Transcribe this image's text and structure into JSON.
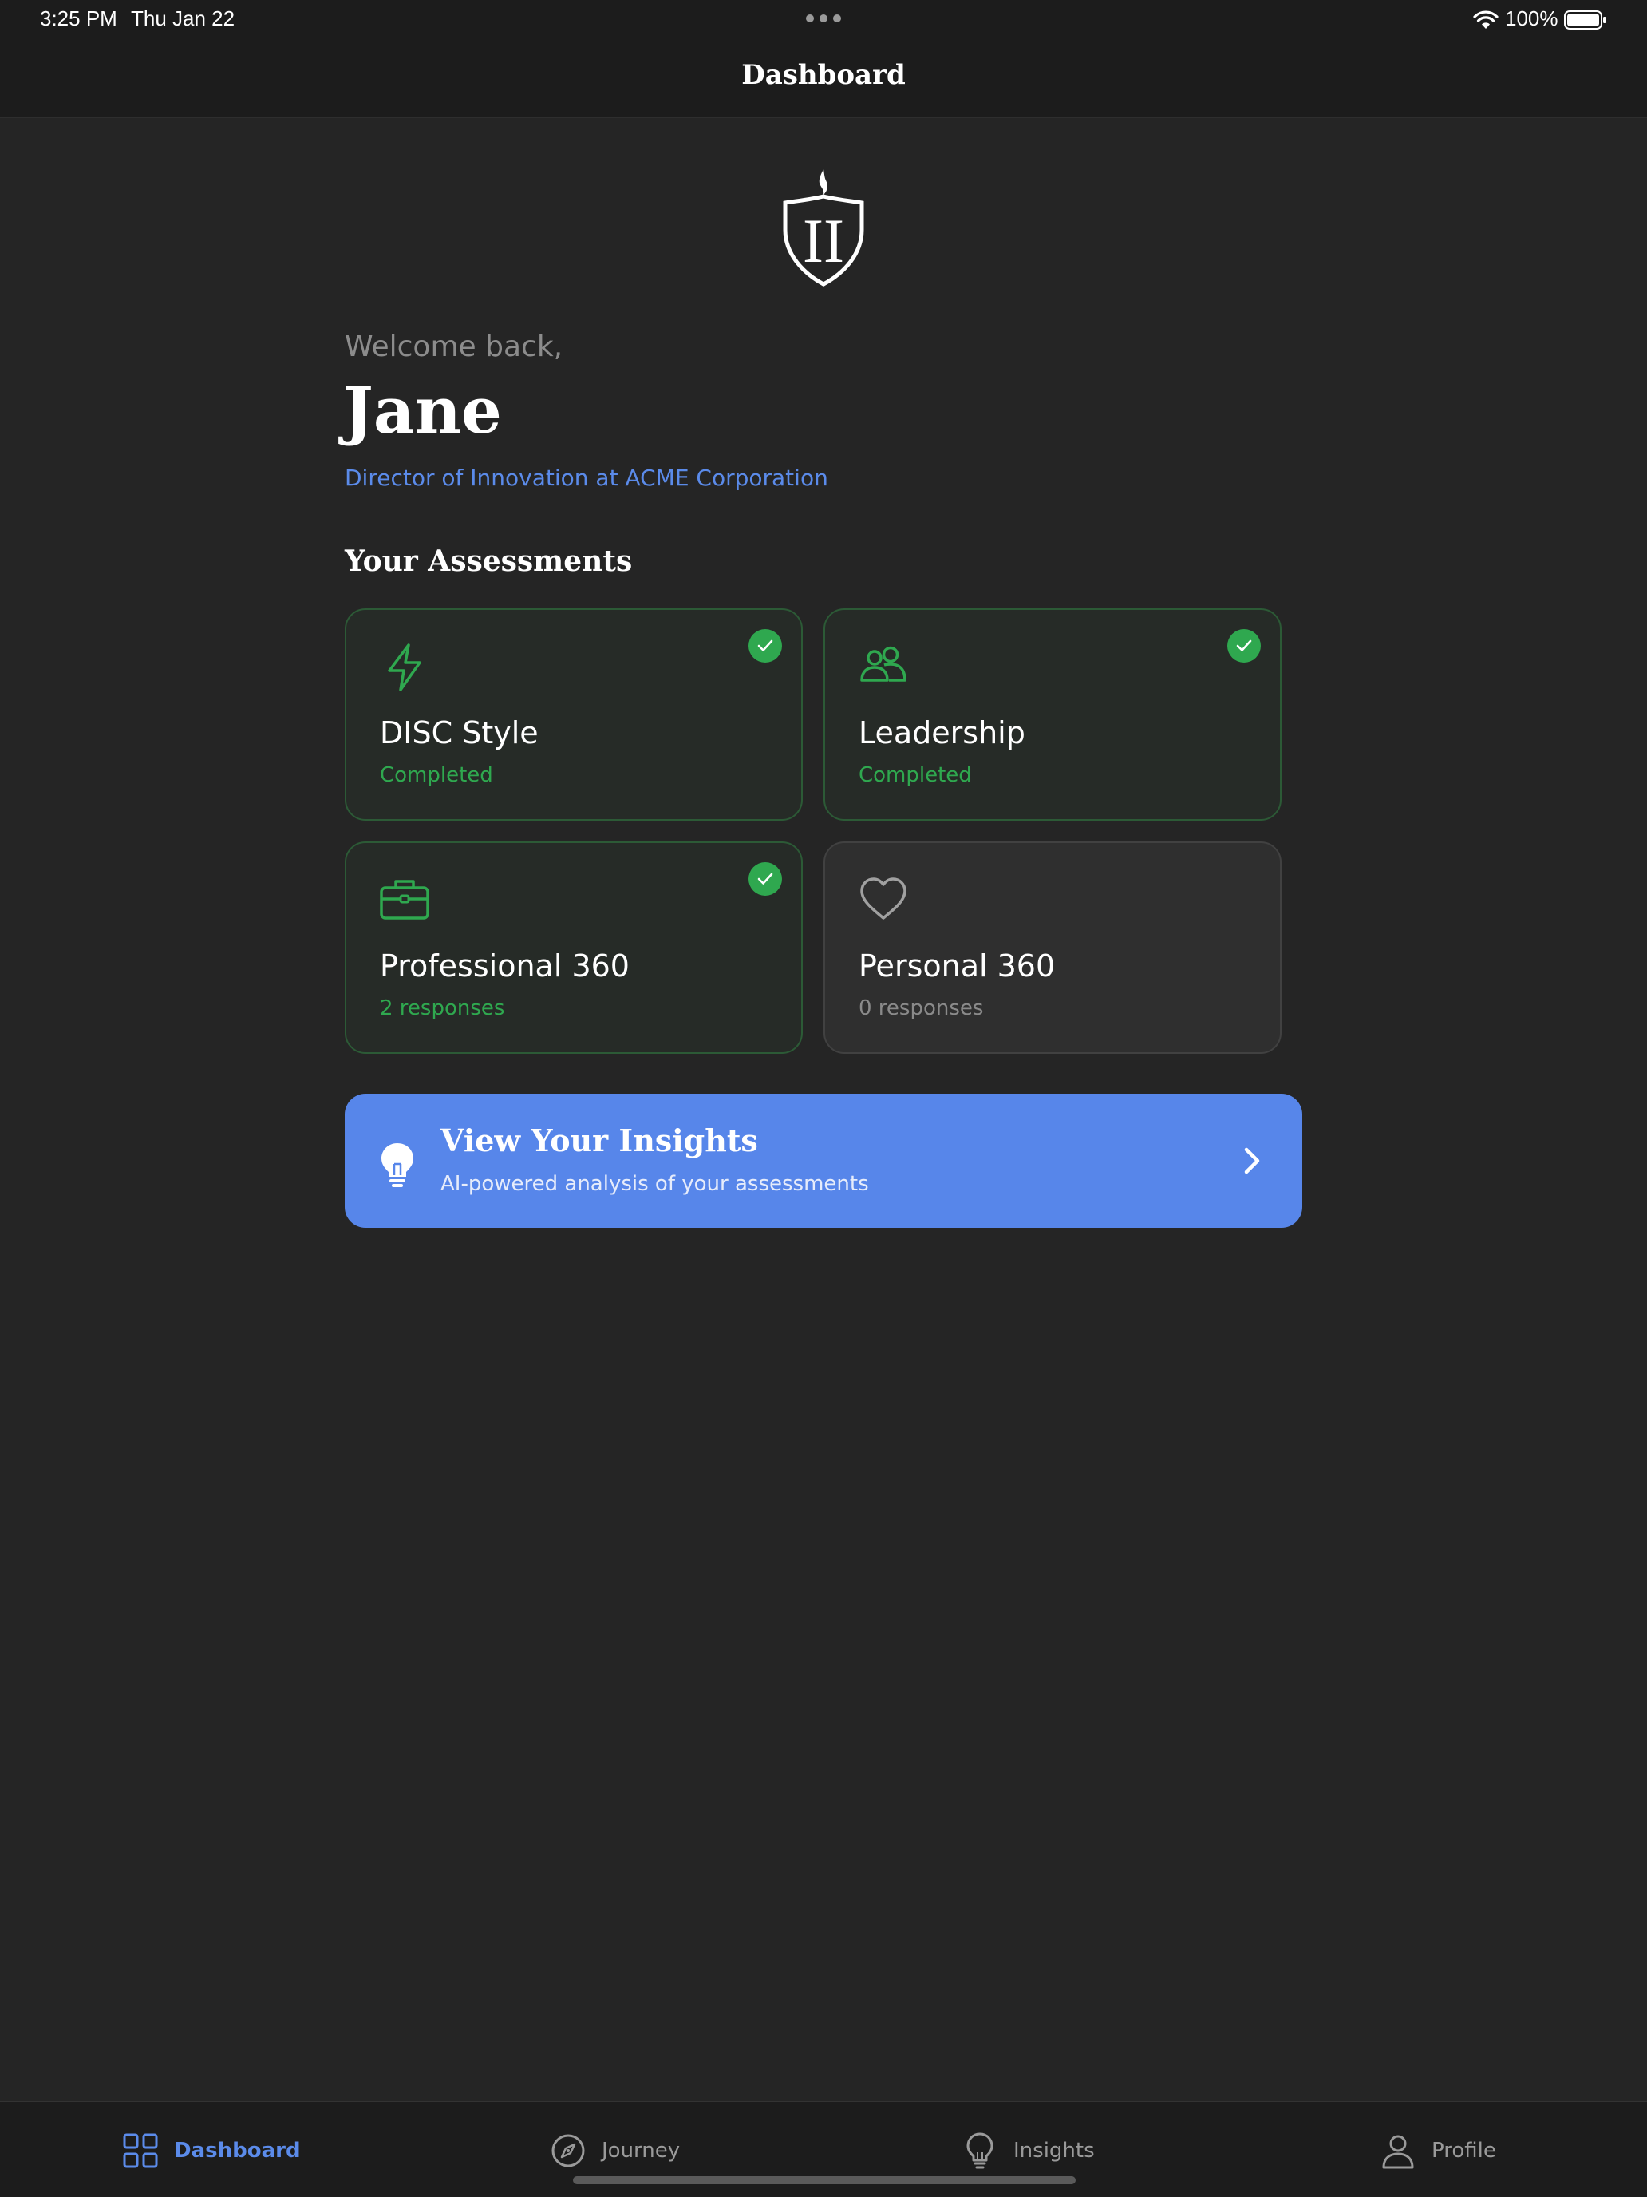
{
  "status_bar": {
    "time": "3:25 PM",
    "date": "Thu Jan 22",
    "battery": "100%"
  },
  "header": {
    "title": "Dashboard"
  },
  "welcome": {
    "greeting": "Welcome back,",
    "name": "Jane",
    "role": "Director of Innovation at ACME Corporation"
  },
  "assessments": {
    "section_title": "Your Assessments",
    "cards": [
      {
        "title": "DISC Style",
        "status": "Completed",
        "icon": "lightning-icon",
        "completed": true
      },
      {
        "title": "Leadership",
        "status": "Completed",
        "icon": "users-icon",
        "completed": true
      },
      {
        "title": "Professional 360",
        "status": "2 responses",
        "icon": "briefcase-icon",
        "completed": true
      },
      {
        "title": "Personal 360",
        "status": "0 responses",
        "icon": "heart-icon",
        "completed": false
      }
    ]
  },
  "insights": {
    "title": "View Your Insights",
    "subtitle": "AI-powered analysis of your assessments"
  },
  "tabs": [
    {
      "label": "Dashboard",
      "icon": "grid-icon",
      "active": true
    },
    {
      "label": "Journey",
      "icon": "compass-icon",
      "active": false
    },
    {
      "label": "Insights",
      "icon": "lightbulb-icon",
      "active": false
    },
    {
      "label": "Profile",
      "icon": "person-icon",
      "active": false
    }
  ],
  "colors": {
    "background": "#252525",
    "accent_blue": "#5786ea",
    "success_green": "#2fa84f",
    "muted_gray": "#8a8a8a"
  }
}
